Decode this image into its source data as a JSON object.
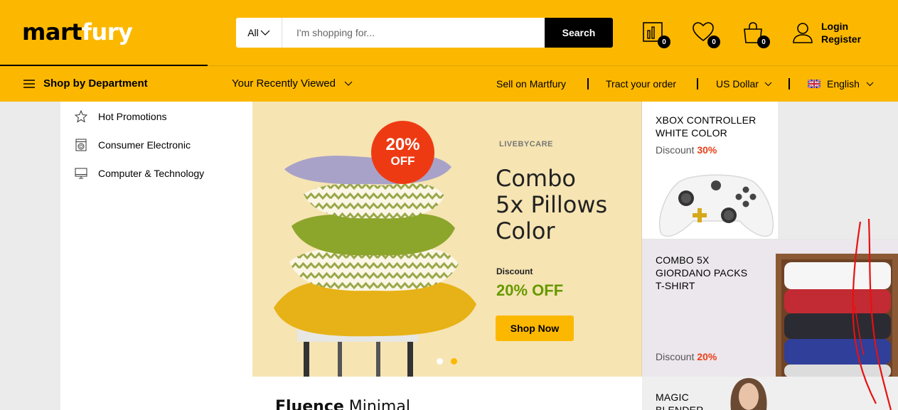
{
  "header": {
    "logo_part1": "mart",
    "logo_part2": "fury",
    "search": {
      "category": "All",
      "placeholder": "I'm shopping for...",
      "button": "Search"
    },
    "compare_count": "0",
    "wishlist_count": "0",
    "cart_count": "0",
    "login": "Login",
    "register": "Register"
  },
  "nav": {
    "department": "Shop by Department",
    "recently_viewed": "Your Recently Viewed",
    "sell": "Sell on Martfury",
    "track": "Tract your order",
    "currency": "US Dollar",
    "language": "English"
  },
  "menu": {
    "items": [
      {
        "label": "Hot Promotions",
        "icon": "star-icon"
      },
      {
        "label": "Consumer Electronic",
        "icon": "washing-machine-icon"
      },
      {
        "label": "Computer & Technology",
        "icon": "monitor-icon"
      }
    ]
  },
  "hero": {
    "badge_percent": "20%",
    "badge_off": "OFF",
    "brand": "LIVEBYCARE",
    "title_lines": [
      "Combo",
      "5x Pillows",
      "Color"
    ],
    "discount_label": "Discount",
    "discount_value": "20% OFF",
    "cta": "Shop Now",
    "slides": 2,
    "active_slide": 2
  },
  "promos": [
    {
      "title_lines": [
        "XBOX CONTROLLER",
        "WHITE COLOR"
      ],
      "discount_label": "Discount",
      "discount_value": "30%"
    },
    {
      "title_lines": [
        "COMBO 5X",
        "GIORDANO PACKS",
        "T-SHIRT"
      ],
      "discount_label": "Discount",
      "discount_value": "20%"
    },
    {
      "title_lines": [
        "MAGIC",
        "BLENDER"
      ]
    }
  ],
  "bottom_banner": {
    "bold": "Fluence",
    "rest": " Minimal"
  },
  "colors": {
    "brand_yellow": "#fcb800",
    "sale_red": "#ee3a13",
    "discount_green": "#669900"
  }
}
